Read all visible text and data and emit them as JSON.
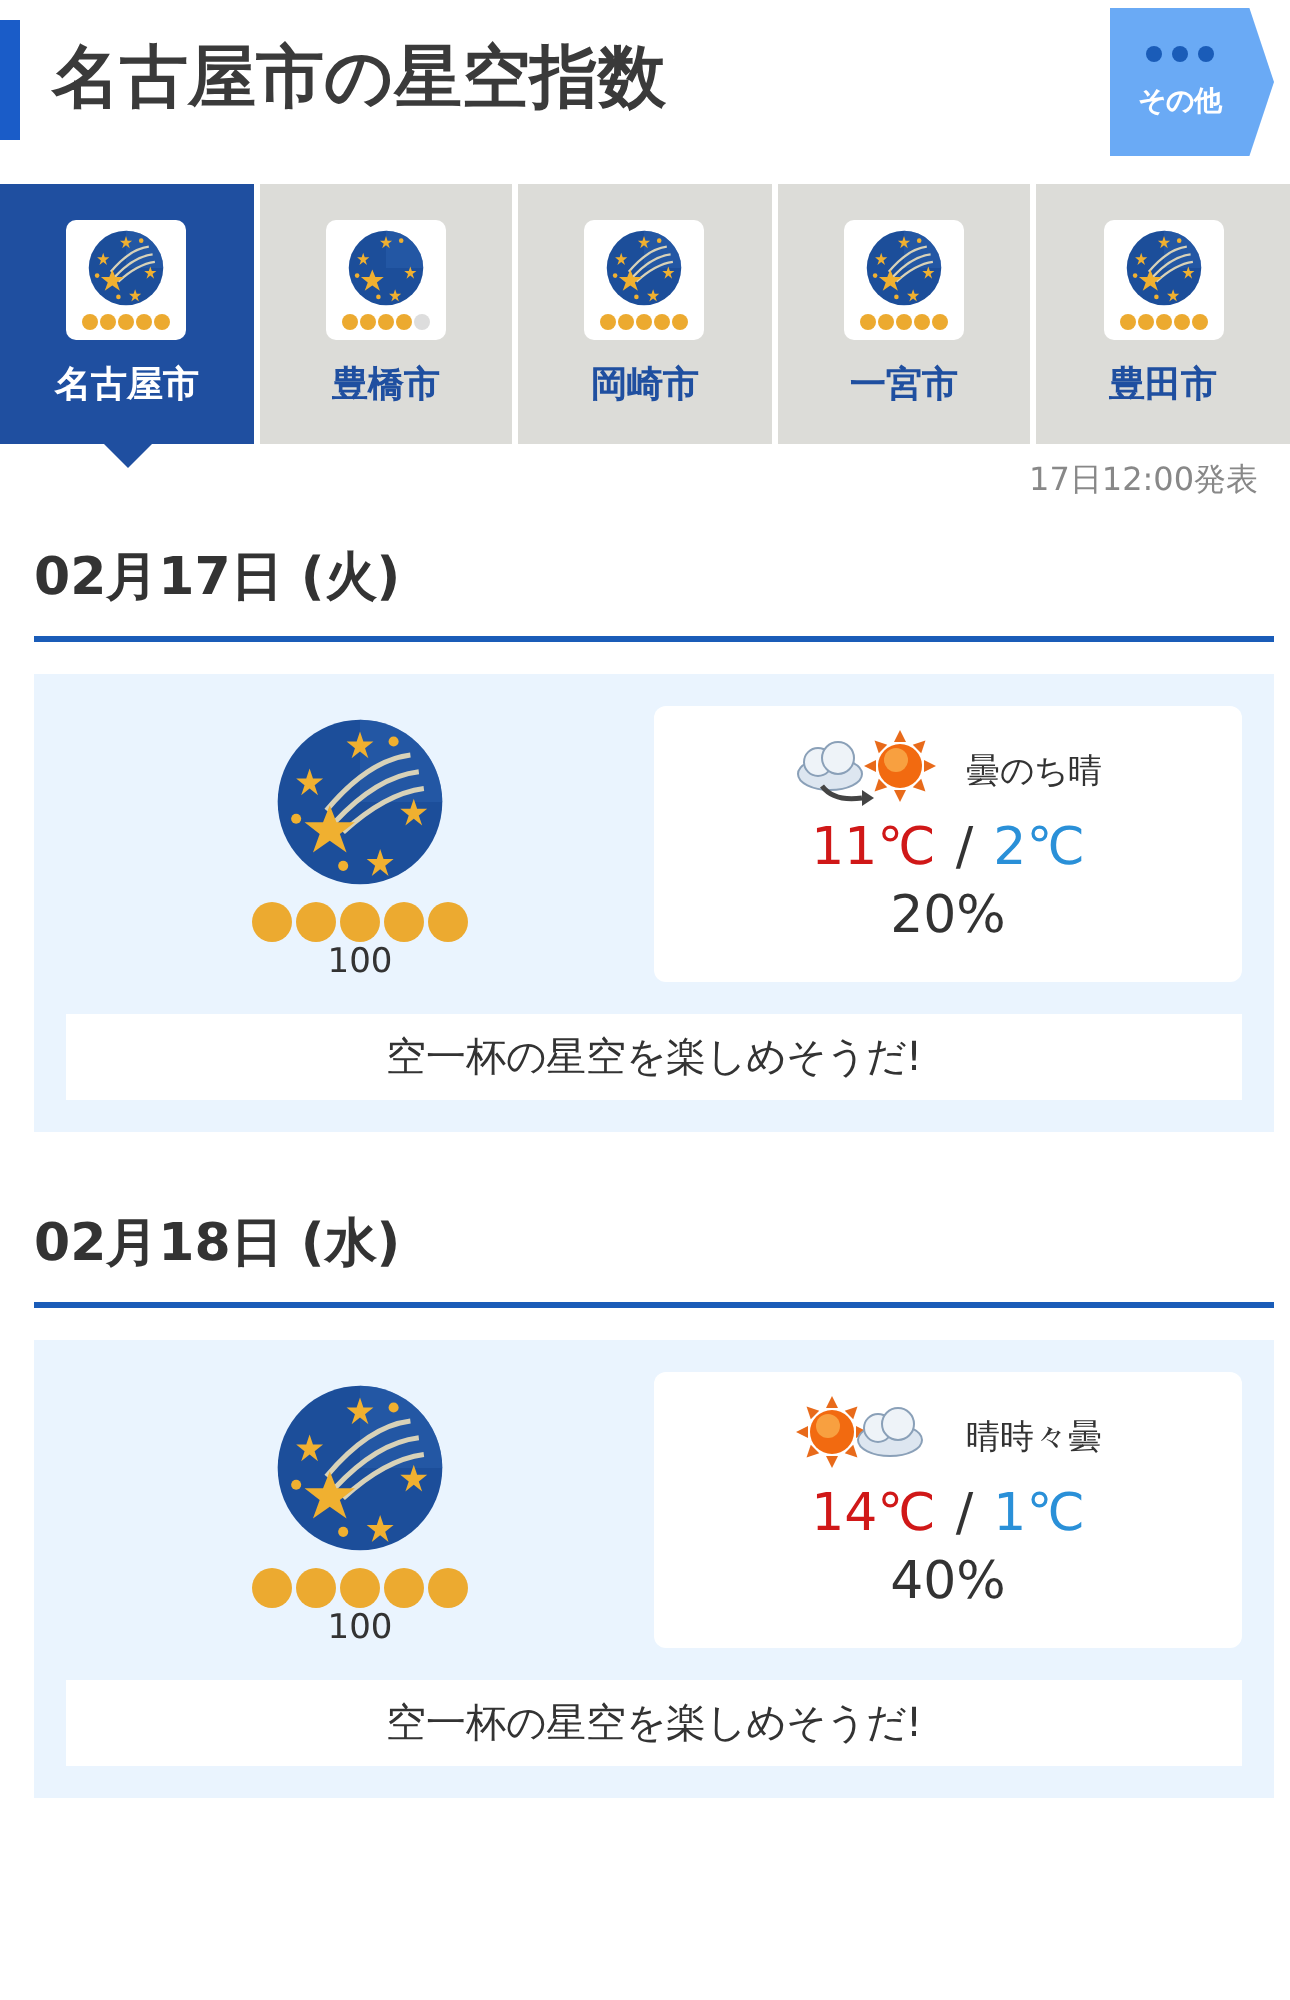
{
  "header": {
    "title": "名古屋市の星空指数",
    "more_button": "その他"
  },
  "tabs": [
    {
      "label": "名古屋市",
      "selected": true,
      "stars": 5
    },
    {
      "label": "豊橋市",
      "selected": false,
      "stars": 4
    },
    {
      "label": "岡崎市",
      "selected": false,
      "stars": 5
    },
    {
      "label": "一宮市",
      "selected": false,
      "stars": 5
    },
    {
      "label": "豊田市",
      "selected": false,
      "stars": 5
    }
  ],
  "published": "17日12:00発表",
  "days": [
    {
      "date": "02月17日 (火)",
      "stars": 5,
      "score": "100",
      "kind": "cloud_then_sun",
      "weather": "曇のち晴",
      "high": "11℃",
      "separator": "/",
      "low": "2℃",
      "rain": "20%",
      "message": "空一杯の星空を楽しめそうだ!"
    },
    {
      "date": "02月18日 (水)",
      "stars": 5,
      "score": "100",
      "kind": "sun_and_cloud",
      "weather": "晴時々曇",
      "high": "14℃",
      "separator": "/",
      "low": "1℃",
      "rain": "40%",
      "message": "空一杯の星空を楽しめそうだ!"
    }
  ]
}
